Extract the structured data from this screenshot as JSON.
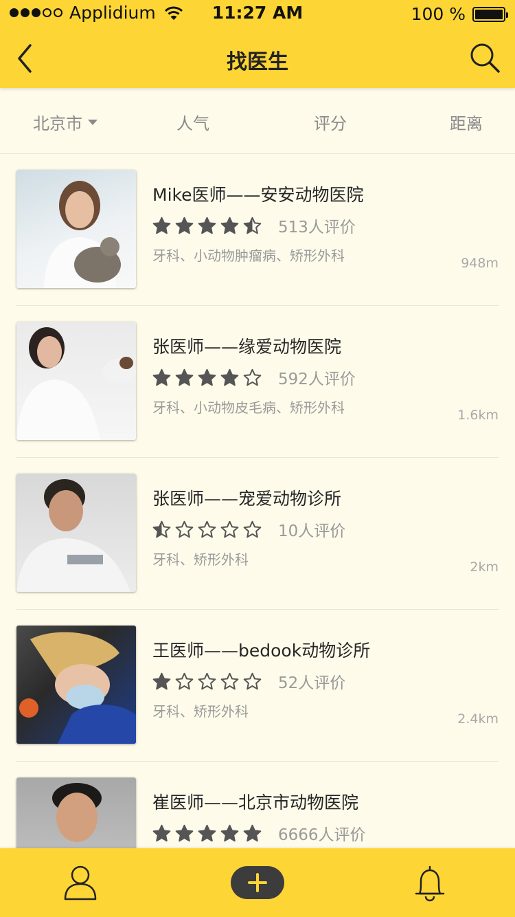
{
  "status_bar": {
    "carrier": "Applidium",
    "time": "11:27 AM",
    "battery_text": "100 %"
  },
  "nav": {
    "title": "找医生",
    "back_icon": "chevron-left-icon",
    "search_icon": "search-icon"
  },
  "filters": [
    {
      "label": "北京市",
      "dropdown": true
    },
    {
      "label": "人气"
    },
    {
      "label": "评分"
    },
    {
      "label": "距离"
    }
  ],
  "doctors": [
    {
      "name": "Mike医师——安安动物医院",
      "rating": 4.5,
      "reviews": "513人评价",
      "tags": "牙科、小动物肿瘤病、矫形外科",
      "distance": "948m"
    },
    {
      "name": "张医师——缘爱动物医院",
      "rating": 4,
      "reviews": "592人评价",
      "tags": "牙科、小动物皮毛病、矫形外科",
      "distance": "1.6km"
    },
    {
      "name": "张医师——宠爱动物诊所",
      "rating": 0.5,
      "reviews": "10人评价",
      "tags": "牙科、矫形外科",
      "distance": "2km"
    },
    {
      "name": "王医师——bedook动物诊所",
      "rating": 1,
      "reviews": "52人评价",
      "tags": "牙科、矫形外科",
      "distance": "2.4km"
    },
    {
      "name": "崔医师——北京市动物医院",
      "rating": 5,
      "reviews": "6666人评价",
      "tags": "",
      "distance": ""
    }
  ],
  "tabbar": {
    "left_icon": "profile-icon",
    "center_icon": "plus-icon",
    "right_icon": "bell-icon"
  },
  "colors": {
    "brand_yellow": "#fdd535",
    "background": "#fffbeb",
    "star": "#555555",
    "text_primary": "#262626",
    "text_secondary": "#9a9a9a"
  }
}
